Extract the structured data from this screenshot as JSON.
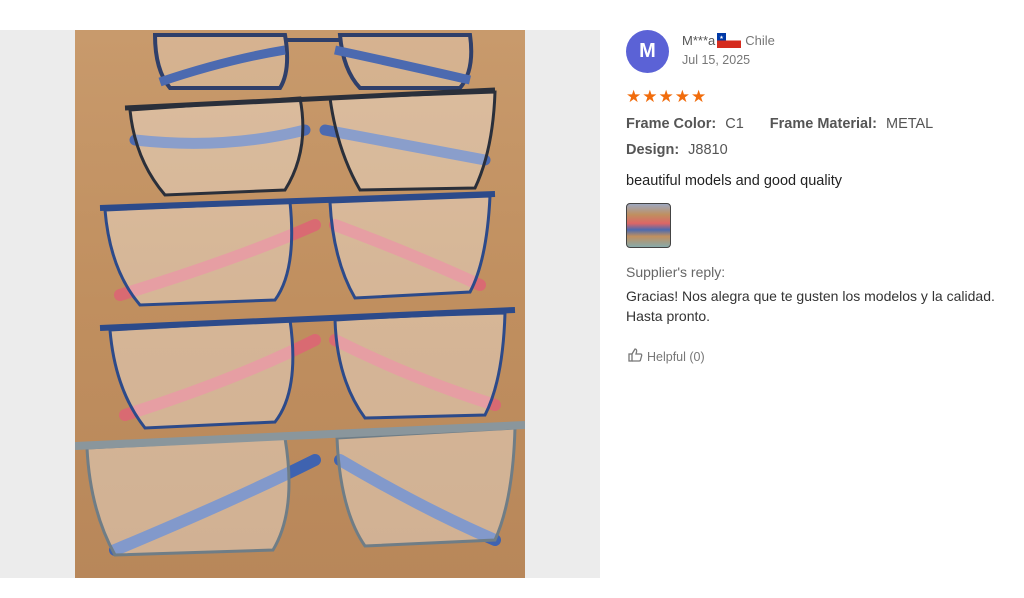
{
  "reviewer": {
    "avatar_letter": "M",
    "name": "M***a",
    "country": "Chile",
    "date": "Jul 15, 2025"
  },
  "rating": {
    "stars": 5,
    "star_glyph": "★",
    "color": "#f16c0c"
  },
  "attributes": {
    "frame_color_label": "Frame Color:",
    "frame_color_value": "C1",
    "frame_material_label": "Frame Material:",
    "frame_material_value": "METAL",
    "design_label": "Design:",
    "design_value": "J8810"
  },
  "review_text": "beautiful models and good quality",
  "supplier_reply": {
    "label": "Supplier's reply:",
    "line1": "Gracias! Nos alegra que te gusten los modelos y la calidad.",
    "line2": "Hasta pronto."
  },
  "helpful": {
    "label": "Helpful (0)",
    "icon": "thumbs-up-icon"
  },
  "photo": {
    "icon": "eyeglasses-photo"
  },
  "colors": {
    "avatar": "#5b62d6",
    "accent": "#f16c0c"
  }
}
